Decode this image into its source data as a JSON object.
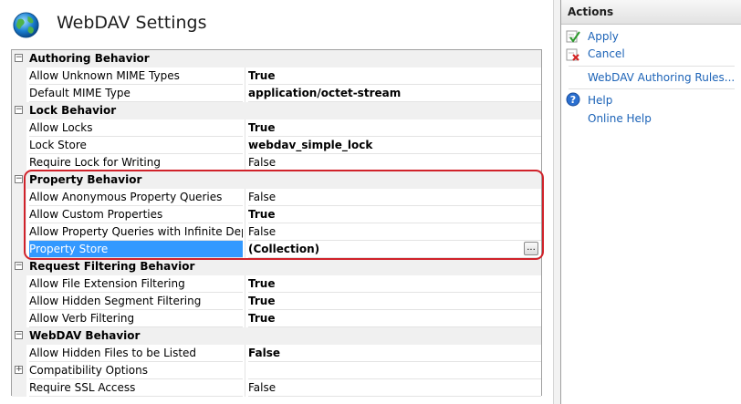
{
  "page": {
    "title": "WebDAV Settings"
  },
  "grid": {
    "rows": [
      {
        "kind": "category",
        "label": "Authoring Behavior",
        "expander": "⊟"
      },
      {
        "kind": "property",
        "name": "Allow Unknown MIME Types",
        "value": "True",
        "bold": true
      },
      {
        "kind": "property",
        "name": "Default MIME Type",
        "value": "application/octet-stream",
        "bold": true
      },
      {
        "kind": "category",
        "label": "Lock Behavior",
        "expander": "⊟"
      },
      {
        "kind": "property",
        "name": "Allow Locks",
        "value": "True",
        "bold": true
      },
      {
        "kind": "property",
        "name": "Lock Store",
        "value": "webdav_simple_lock",
        "bold": true
      },
      {
        "kind": "property",
        "name": "Require Lock for Writing",
        "value": "False",
        "bold": false
      },
      {
        "kind": "category",
        "label": "Property Behavior",
        "expander": "⊟"
      },
      {
        "kind": "property",
        "name": "Allow Anonymous Property Queries",
        "value": "False",
        "bold": false
      },
      {
        "kind": "property",
        "name": "Allow Custom Properties",
        "value": "True",
        "bold": true
      },
      {
        "kind": "property",
        "name": "Allow Property Queries with Infinite Depth",
        "value": "False",
        "bold": false
      },
      {
        "kind": "property",
        "name": "Property Store",
        "value": "(Collection)",
        "bold": true,
        "selected": true,
        "button": "..."
      },
      {
        "kind": "category",
        "label": "Request Filtering Behavior",
        "expander": "⊟"
      },
      {
        "kind": "property",
        "name": "Allow File Extension Filtering",
        "value": "True",
        "bold": true
      },
      {
        "kind": "property",
        "name": "Allow Hidden Segment Filtering",
        "value": "True",
        "bold": true
      },
      {
        "kind": "property",
        "name": "Allow Verb Filtering",
        "value": "True",
        "bold": true
      },
      {
        "kind": "category",
        "label": "WebDAV Behavior",
        "expander": "⊟"
      },
      {
        "kind": "property",
        "name": "Allow Hidden Files to be Listed",
        "value": "False",
        "bold": true
      },
      {
        "kind": "property",
        "name": "Compatibility Options",
        "value": "",
        "bold": false,
        "expander": "⊞"
      },
      {
        "kind": "property",
        "name": "Require SSL Access",
        "value": "False",
        "bold": false
      }
    ]
  },
  "actions": {
    "title": "Actions",
    "apply": "Apply",
    "cancel": "Cancel",
    "authoring_rules": "WebDAV Authoring Rules...",
    "help": "Help",
    "online_help": "Online Help"
  },
  "colors": {
    "link": "#1c63b7",
    "selection": "#3399ff",
    "highlight_border": "#d0222a"
  },
  "icons": [
    "globe-icon",
    "apply-check-icon",
    "cancel-x-icon",
    "help-icon"
  ]
}
